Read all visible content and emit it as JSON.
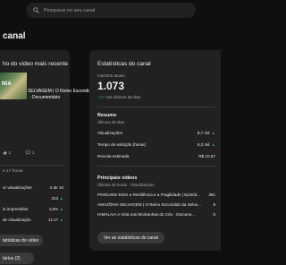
{
  "search": {
    "placeholder": "Pesquisar no seu canal"
  },
  "page_title": "canal",
  "latest_video": {
    "header": "ho do vídeo mais recente",
    "thumbnail_text": "NIA",
    "title_line1": "SELVAGEM | O Reino Escondido",
    "title_line2": "- Documentário",
    "stats": [
      "2",
      "1"
    ],
    "ranking": "e 17 horas",
    "rows": [
      {
        "label": "or visualizações",
        "value": "4 de 10"
      },
      {
        "label": "",
        "value": "313"
      },
      {
        "label": "io impressões",
        "value": "1,5%"
      },
      {
        "label": "de visualização",
        "value": "11:17"
      }
    ],
    "analytics_button": "tatísticas do vídeo",
    "comments_button": "tários (2)"
  },
  "channel_stats": {
    "title": "Estatísticas do canal",
    "subs_label": "Inscritos atuais",
    "subs_count": "1.073",
    "subs_trend_value": "+37",
    "subs_trend_text": "nos últimos 28 dias",
    "summary": {
      "heading": "Resumo",
      "sub": "Últimos 28 dias",
      "rows": [
        {
          "label": "Visualizações",
          "value": "8,7 mil",
          "arrow": "up"
        },
        {
          "label": "Tempo de exibição (horas)",
          "value": "5,2 mil",
          "arrow": "up"
        },
        {
          "label": "Receita estimada",
          "value": "R$ 10,67",
          "arrow": ""
        }
      ]
    },
    "top_videos": {
      "heading": "Principais vídeos",
      "sub": "Últimas 48 horas · Visualizações",
      "rows": [
        {
          "label": "PINGUINS Entre a Resiliência e a Fragilidade | Episód...",
          "value": "351"
        },
        {
          "label": "AMAZÔNIA SELVAGEM | O Reino Escondido da Selva...",
          "value": "9"
        },
        {
          "label": "HIMALAIA A Vida nas Montanhas do Céu · Docume...",
          "value": "5"
        }
      ]
    },
    "analytics_button": "Ver as estatísticas do canal"
  },
  "colors": {
    "background": "#0f0f0f",
    "card": "#212121",
    "positive": "#2ba640",
    "muted": "#aaaaaa"
  },
  "icons": [
    "search-icon",
    "arrow-up-icon",
    "like-icon",
    "comment-icon"
  ]
}
